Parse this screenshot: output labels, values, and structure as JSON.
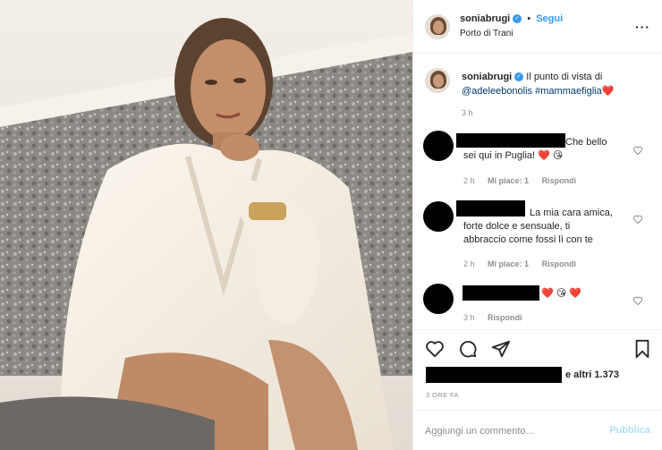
{
  "post": {
    "image_alt": "",
    "author": "soniabrugi",
    "follow_label": "Segui",
    "location": "Porto di Trani",
    "more_icon": "more-options-icon"
  },
  "caption": {
    "username": "soniabrugi",
    "text_before": "Il punto di vista di",
    "mention": "@adeleebonolis",
    "hashtag": "#mammaefiglia",
    "emoji": "❤️",
    "time": "3 h"
  },
  "comments": [
    {
      "text_line1": "Che bello",
      "text_line2": "sei qui in Puglia! ❤️ 😘",
      "time": "2 h",
      "likes": "Mi piace: 1",
      "reply": "Rispondi"
    },
    {
      "text_line1": "La mia cara amica,",
      "text_line2": "forte dolce e sensuale, ti",
      "text_line3": "abbraccio come fossi lì con te",
      "time": "2 h",
      "likes": "Mi piace: 1",
      "reply": "Rispondi"
    },
    {
      "text_line1": "❤️ 😘 ❤️",
      "time": "3 h",
      "reply": "Rispondi"
    }
  ],
  "likes_suffix": "e altri 1.373",
  "time_ago": "3 ORE FA",
  "comment_input": {
    "placeholder": "Aggiungi un commento...",
    "publish_label": "Pubblica"
  },
  "colors": {
    "accent_blue": "#3897f0",
    "publish_disabled": "#b2dffc",
    "heart_red": "#e21b3c",
    "mention_blue": "#00376b",
    "muted": "#8e8e8e"
  }
}
